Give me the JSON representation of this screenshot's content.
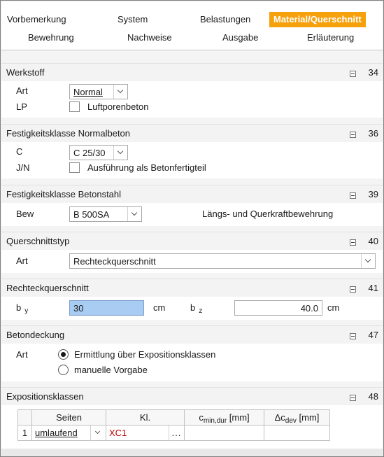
{
  "tabs": {
    "row1": [
      "Vorbemerkung",
      "System",
      "Belastungen",
      "Material/Querschnitt"
    ],
    "row2": [
      "Bewehrung",
      "Nachweise",
      "Ausgabe",
      "Erläuterung"
    ],
    "active": "Material/Querschnitt",
    "active_color": "#f6a00c"
  },
  "werkstoff": {
    "title": "Werkstoff",
    "num": "34",
    "art_label": "Art",
    "art_value": "Normal",
    "lp_label": "LP",
    "lp_checkbox_label": "Luftporenbeton",
    "lp_checked": false
  },
  "festigkeit_beton": {
    "title": "Festigkeitsklasse Normalbeton",
    "num": "36",
    "c_label": "C",
    "c_value": "C 25/30",
    "jn_label": "J/N",
    "jn_checkbox_label": "Ausführung als Betonfertigteil",
    "jn_checked": false
  },
  "festigkeit_stahl": {
    "title": "Festigkeitsklasse Betonstahl",
    "num": "39",
    "bew_label": "Bew",
    "bew_value": "B 500SA",
    "note": "Längs- und Querkraftbewehrung"
  },
  "querschnittstyp": {
    "title": "Querschnittstyp",
    "num": "40",
    "art_label": "Art",
    "art_value": "Rechteckquerschnitt"
  },
  "rechteck": {
    "title": "Rechteckquerschnitt",
    "num": "41",
    "by_label": "b",
    "by_sub": "y",
    "by_value": "30",
    "by_unit": "cm",
    "bz_label": "b",
    "bz_sub": "z",
    "bz_value": "40.0",
    "bz_unit": "cm"
  },
  "betondeckung": {
    "title": "Betondeckung",
    "num": "47",
    "art_label": "Art",
    "option1": "Ermittlung über Expositionsklassen",
    "option2": "manuelle Vorgabe",
    "selected": 1
  },
  "exposition": {
    "title": "Expositionsklassen",
    "num": "48",
    "headers": {
      "seiten": "Seiten",
      "kl": "Kl.",
      "cmin": "c",
      "cmin_sub": "min,dur",
      "cmin_unit": " [mm]",
      "dc": "Δc",
      "dc_sub": "dev",
      "dc_unit": " [mm]"
    },
    "rows": [
      {
        "nr": "1",
        "seiten": "umlaufend",
        "kl": "XC1",
        "dots": "...",
        "cmin": "",
        "dc": ""
      }
    ]
  }
}
